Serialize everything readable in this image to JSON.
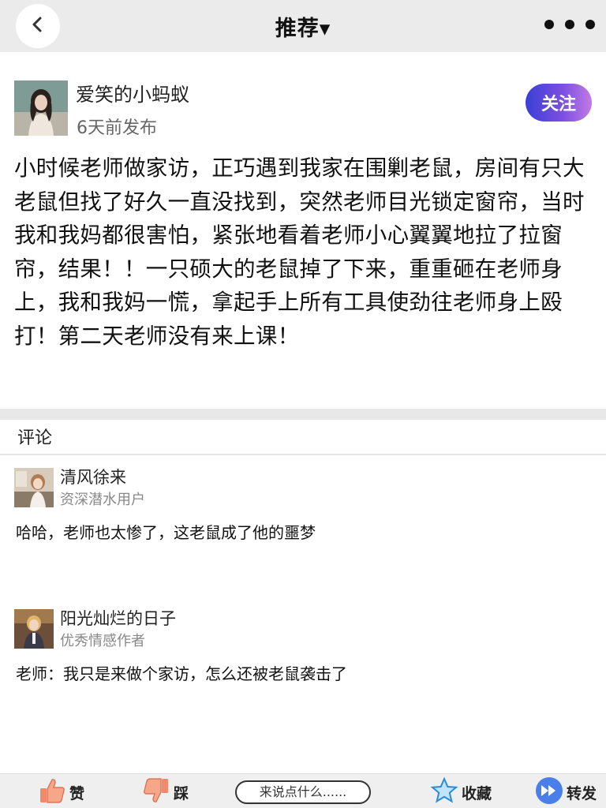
{
  "header": {
    "title": "推荐▾"
  },
  "post": {
    "author_name": "爱笑的小蚂蚁",
    "published": "6天前发布",
    "follow_label": "关注",
    "body": "小时候老师做家访，正巧遇到我家在围剿老鼠，房间有只大老鼠但找了好久一直没找到，突然老师目光锁定窗帘，当时我和我妈都很害怕，紧张地看着老师小心翼翼地拉了拉窗帘，结果！！一只硕大的老鼠掉了下来，重重砸在老师身上，我和我妈一慌，拿起手上所有工具使劲往老师身上殴打！第二天老师没有来上课！"
  },
  "comments": {
    "title": "评论",
    "items": [
      {
        "name": "清风徐来",
        "tag": "资深潜水用户",
        "text": "哈哈，老师也太惨了，这老鼠成了他的噩梦"
      },
      {
        "name": "阳光灿烂的日子",
        "tag": "优秀情感作者",
        "text": "老师：我只是来做个家访，怎么还被老鼠袭击了"
      }
    ]
  },
  "bottom_bar": {
    "like_label": "赞",
    "dislike_label": "踩",
    "comment_placeholder": "来说点什么......",
    "favorite_label": "收藏",
    "share_label": "转发"
  },
  "colors": {
    "follow_gradient_start": "#3b3fd6",
    "follow_gradient_end": "#c27ae6",
    "like_icon": "#f08a6a",
    "favorite_icon": "#2a8bd6",
    "share_icon": "#4a7ee8"
  },
  "icons": {
    "back": "chevron-left-icon",
    "more": "more-dots-icon",
    "like": "thumbs-up-icon",
    "dislike": "thumbs-down-icon",
    "favorite": "star-icon",
    "share": "fast-forward-icon"
  }
}
